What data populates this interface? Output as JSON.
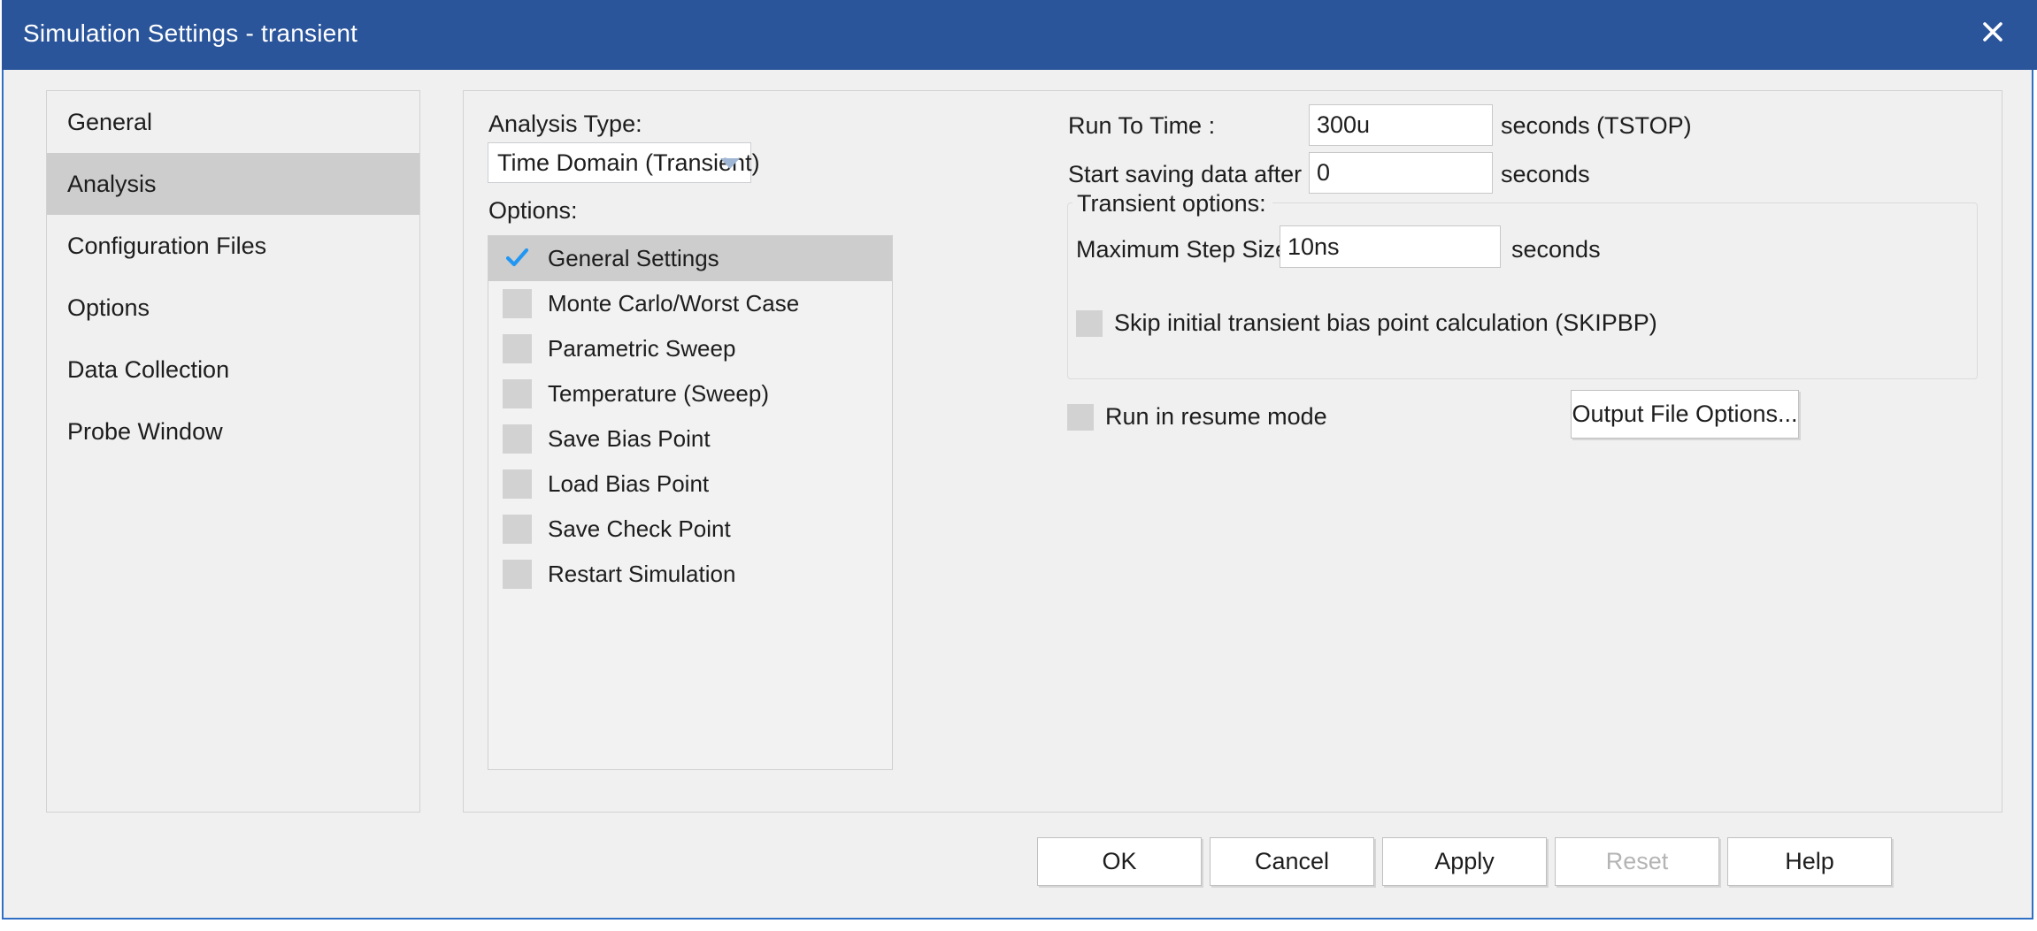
{
  "window": {
    "title": "Simulation Settings - transient",
    "close_icon": "close-icon",
    "title_bar_color": "#2b559a",
    "border_color": "#2f6fc4"
  },
  "categories": {
    "items": [
      {
        "label": "General",
        "selected": false
      },
      {
        "label": "Analysis",
        "selected": true
      },
      {
        "label": "Configuration Files",
        "selected": false
      },
      {
        "label": "Options",
        "selected": false
      },
      {
        "label": "Data Collection",
        "selected": false
      },
      {
        "label": "Probe Window",
        "selected": false
      }
    ]
  },
  "analysis": {
    "type_label": "Analysis Type:",
    "type_value": "Time Domain (Transient)",
    "type_arrow_icon": "chevron-down-icon",
    "options_label": "Options:",
    "options": [
      {
        "label": "General Settings",
        "checked": true,
        "selected": true
      },
      {
        "label": "Monte Carlo/Worst Case",
        "checked": false,
        "selected": false
      },
      {
        "label": "Parametric Sweep",
        "checked": false,
        "selected": false
      },
      {
        "label": "Temperature (Sweep)",
        "checked": false,
        "selected": false
      },
      {
        "label": "Save Bias Point",
        "checked": false,
        "selected": false
      },
      {
        "label": "Load Bias Point",
        "checked": false,
        "selected": false
      },
      {
        "label": "Save Check Point",
        "checked": false,
        "selected": false
      },
      {
        "label": "Restart Simulation",
        "checked": false,
        "selected": false
      }
    ],
    "check_color": "#2196f3"
  },
  "general_settings": {
    "run_to_time": {
      "label": "Run To Time :",
      "value": "300u",
      "unit": "seconds (TSTOP)"
    },
    "start_saving": {
      "label": "Start saving data after :",
      "value": "0",
      "unit": "seconds"
    },
    "transient_options": {
      "group_label": "Transient options:",
      "max_step": {
        "label": "Maximum Step Size",
        "value": "10ns",
        "unit": "seconds"
      },
      "skipbp": {
        "label": "Skip initial transient bias point calculation (SKIPBP)",
        "checked": false
      }
    },
    "resume_mode": {
      "label": "Run in resume mode",
      "checked": false
    },
    "output_file_options_label": "Output File Options..."
  },
  "buttons": {
    "ok": "OK",
    "cancel": "Cancel",
    "apply": "Apply",
    "reset": "Reset",
    "reset_enabled": false,
    "help": "Help"
  }
}
